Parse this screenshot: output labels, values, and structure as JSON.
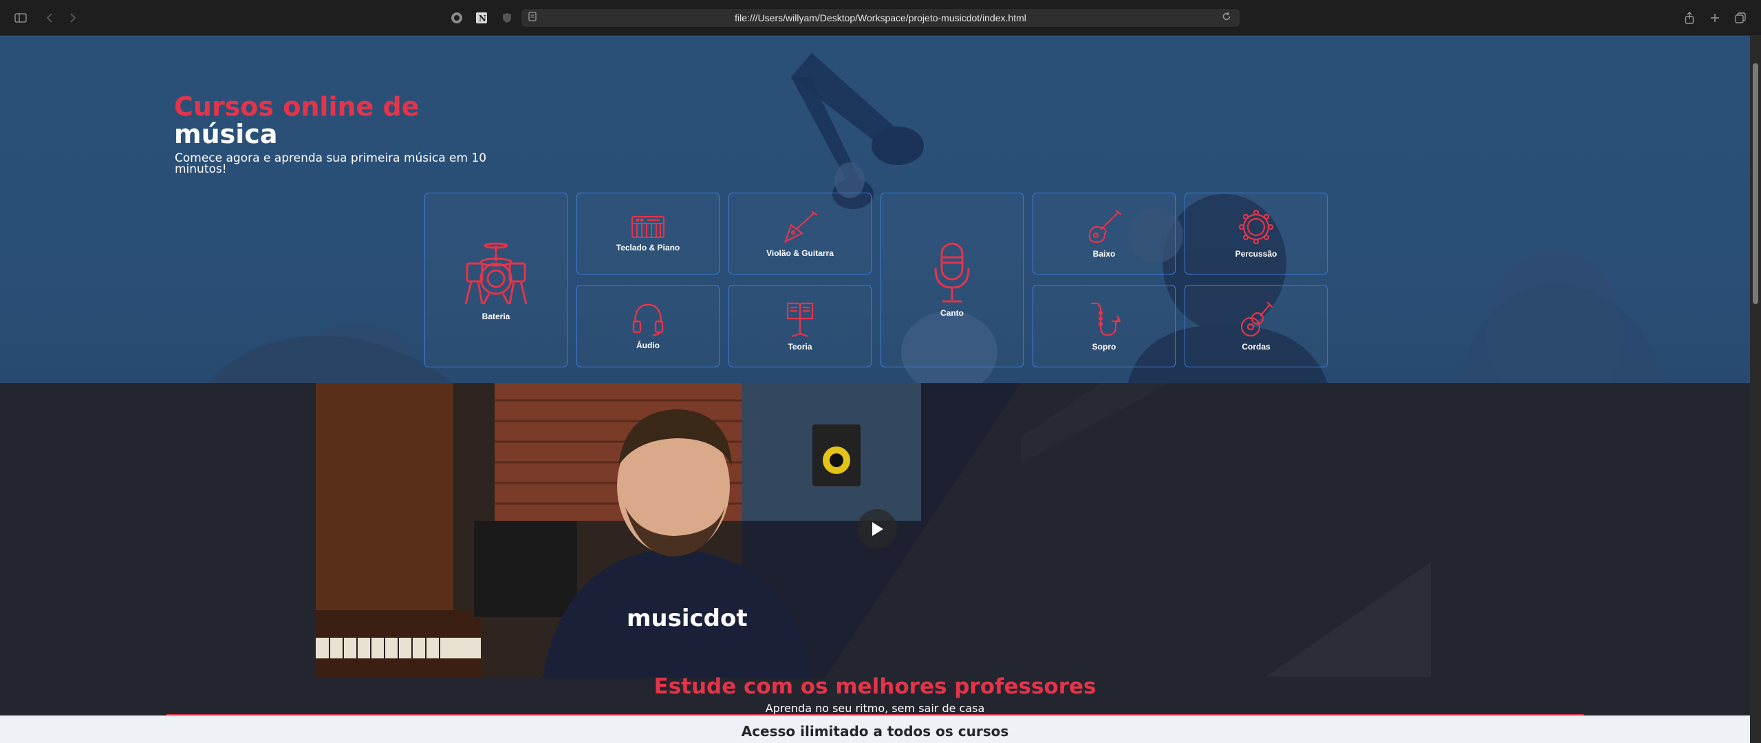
{
  "browser": {
    "url": "file:///Users/willyam/Desktop/Workspace/projeto-musicdot/index.html"
  },
  "hero": {
    "title_line1": "Cursos online de",
    "title_line2": "música",
    "subtitle": "Comece agora e aprenda sua primeira música em 10 minutos!"
  },
  "categories": [
    {
      "label": "Bateria",
      "icon": "drum-kit-icon"
    },
    {
      "label": "Teclado & Piano",
      "icon": "keyboard-icon"
    },
    {
      "label": "Violão & Guitarra",
      "icon": "electric-guitar-icon"
    },
    {
      "label": "Canto",
      "icon": "microphone-icon"
    },
    {
      "label": "Baixo",
      "icon": "bass-guitar-icon"
    },
    {
      "label": "Percussão",
      "icon": "tambourine-icon"
    },
    {
      "label": "Áudio",
      "icon": "headphones-icon"
    },
    {
      "label": "Teoria",
      "icon": "music-stand-icon"
    },
    {
      "label": "Sopro",
      "icon": "saxophone-icon"
    },
    {
      "label": "Cordas",
      "icon": "ukulele-icon"
    }
  ],
  "video": {
    "shirt_brand": "musicdot"
  },
  "teachers": {
    "title": "Estude com os melhores professores",
    "subtitle": "Aprenda no seu ritmo, sem sair de casa"
  },
  "access": {
    "title": "Acesso ilimitado a todos os cursos"
  },
  "colors": {
    "accent": "#e5344a",
    "card_border": "#3f7bd6",
    "hero_bg": "#2b5078",
    "dark_bg": "#23262f"
  }
}
